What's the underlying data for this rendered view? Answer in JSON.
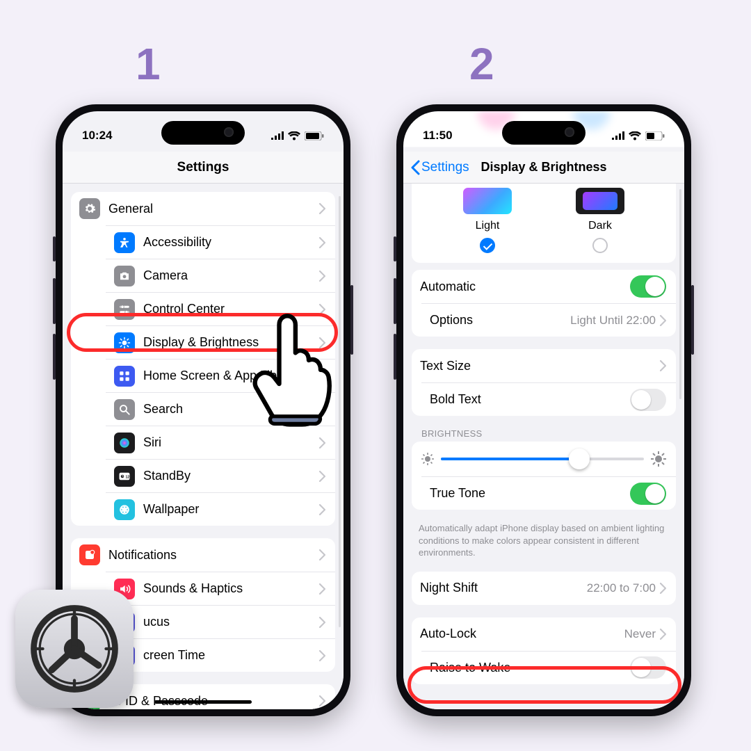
{
  "steps": {
    "one": "1",
    "two": "2"
  },
  "phone1": {
    "time": "10:24",
    "title": "Settings",
    "group1": [
      {
        "icon": "gear",
        "bg": "#8e8e93",
        "label": "General"
      },
      {
        "icon": "access",
        "bg": "#007aff",
        "label": "Accessibility"
      },
      {
        "icon": "camera",
        "bg": "#8e8e93",
        "label": "Camera"
      },
      {
        "icon": "cc",
        "bg": "#8e8e93",
        "label": "Control Center"
      },
      {
        "icon": "bright",
        "bg": "#007aff",
        "label": "Display & Brightness"
      },
      {
        "icon": "home",
        "bg": "#3d5af1",
        "label": "Home Screen & App Library"
      },
      {
        "icon": "search",
        "bg": "#8e8e93",
        "label": "Search"
      },
      {
        "icon": "siri",
        "bg": "#1c1c1e",
        "label": "Siri"
      },
      {
        "icon": "standby",
        "bg": "#1c1c1e",
        "label": "StandBy"
      },
      {
        "icon": "wall",
        "bg": "#23c1e0",
        "label": "Wallpaper"
      }
    ],
    "group2": [
      {
        "icon": "notif",
        "bg": "#ff3b30",
        "label": "Notifications"
      },
      {
        "icon": "sound",
        "bg": "#ff2d55",
        "label": "Sounds & Haptics"
      },
      {
        "icon": "focus",
        "bg": "#5856d6",
        "label": "Focus",
        "trunc": "ucus"
      },
      {
        "icon": "time",
        "bg": "#5856d6",
        "label": "Screen Time",
        "trunc": "creen Time"
      }
    ],
    "group3": [
      {
        "icon": "faceid",
        "bg": "#34c759",
        "label": "Face ID & Passcode",
        "trunc": "ce ID & Passcode"
      }
    ]
  },
  "phone2": {
    "time": "11:50",
    "back": "Settings",
    "title": "Display & Brightness",
    "appearance": {
      "light": "Light",
      "dark": "Dark",
      "automatic": "Automatic",
      "options": "Options",
      "options_val": "Light Until 22:00"
    },
    "text_size": "Text Size",
    "bold_text": "Bold Text",
    "brightness_header": "BRIGHTNESS",
    "true_tone": "True Tone",
    "true_tone_desc": "Automatically adapt iPhone display based on ambient lighting conditions to make colors appear consistent in different environments.",
    "night_shift": "Night Shift",
    "night_shift_val": "22:00 to 7:00",
    "auto_lock": "Auto-Lock",
    "auto_lock_val": "Never",
    "raise_to_wake": "Raise to Wake"
  }
}
